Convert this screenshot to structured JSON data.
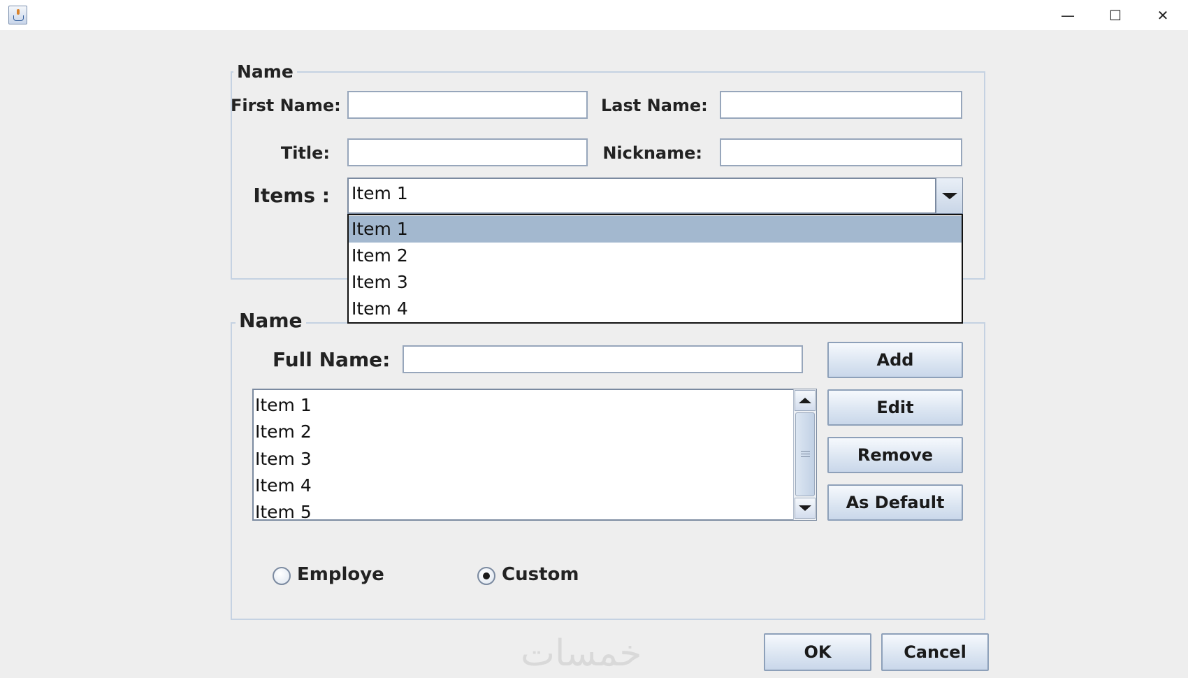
{
  "window": {
    "minimize_glyph": "—",
    "maximize_glyph": "☐",
    "close_glyph": "✕",
    "icon": "java-app-icon"
  },
  "name_group": {
    "legend": "Name",
    "first_name_label": "First Name:",
    "first_name_value": "",
    "last_name_label": "Last Name:",
    "last_name_value": "",
    "title_label": "Title:",
    "title_value": "",
    "nickname_label": "Nickname:",
    "nickname_value": "",
    "items_label": "Items :",
    "combo_selected": "Item 1",
    "combo_options": [
      "Item 1",
      "Item 2",
      "Item 3",
      "Item 4"
    ],
    "combo_highlighted_index": 0
  },
  "list_group": {
    "legend": "Name",
    "full_name_label": "Full Name:",
    "full_name_value": "",
    "list_items": [
      "Item 1",
      "Item 2",
      "Item 3",
      "Item 4",
      "Item 5"
    ],
    "add_label": "Add",
    "edit_label": "Edit",
    "remove_label": "Remove",
    "as_default_label": "As Default",
    "radio_employe_label": "Employe",
    "radio_custom_label": "Custom",
    "selected_radio": "Custom"
  },
  "footer": {
    "ok_label": "OK",
    "cancel_label": "Cancel",
    "watermark": "خمسات"
  },
  "colors": {
    "background": "#eeeeee",
    "selection": "#a3b8cf",
    "group_border": "#c5d2e2"
  }
}
